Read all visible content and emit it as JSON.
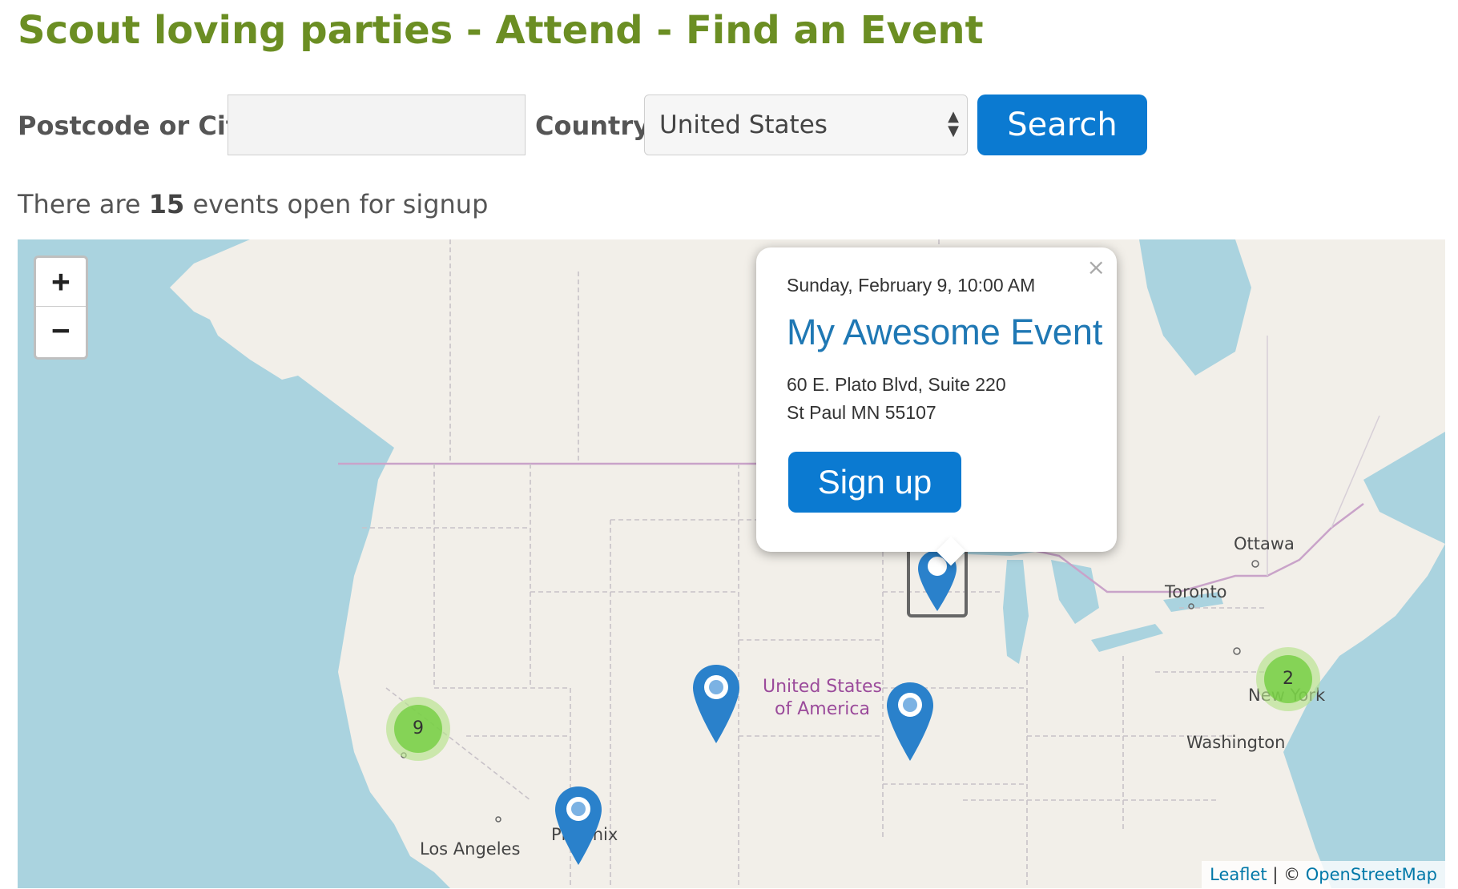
{
  "page": {
    "title": "Scout loving parties - Attend - Find an Event"
  },
  "search": {
    "city_label": "Postcode or City:",
    "city_value": "",
    "city_placeholder": "",
    "country_label": "Country:",
    "country_selected": "United States",
    "search_label": "Search"
  },
  "results": {
    "prefix": "There are",
    "count": "15",
    "suffix": "events open for signup"
  },
  "map": {
    "zoom_in": "+",
    "zoom_out": "−",
    "country_label_line1": "United States",
    "country_label_line2": "of America",
    "cities": {
      "ottawa": "Ottawa",
      "toronto": "Toronto",
      "new_york": "New York",
      "washington": "Washington",
      "los_angeles": "Los Angeles",
      "phoenix": "Phoenix"
    },
    "clusters": {
      "west": "9",
      "east": "2"
    },
    "colors": {
      "water": "#aad3df",
      "land": "#f2efe9",
      "marker": "#2a81cb",
      "cluster_inner": "#6ecc39",
      "country_label": "#9b4b9b"
    },
    "attribution": {
      "leaflet": "Leaflet",
      "separator": " | © ",
      "osm": "OpenStreetMap"
    }
  },
  "popup": {
    "close": "×",
    "date": "Sunday, February 9, 10:00 AM",
    "title": "My Awesome Event",
    "address_line1": "60 E. Plato Blvd, Suite 220",
    "address_line2": "St Paul MN 55107",
    "signup_label": "Sign up"
  }
}
